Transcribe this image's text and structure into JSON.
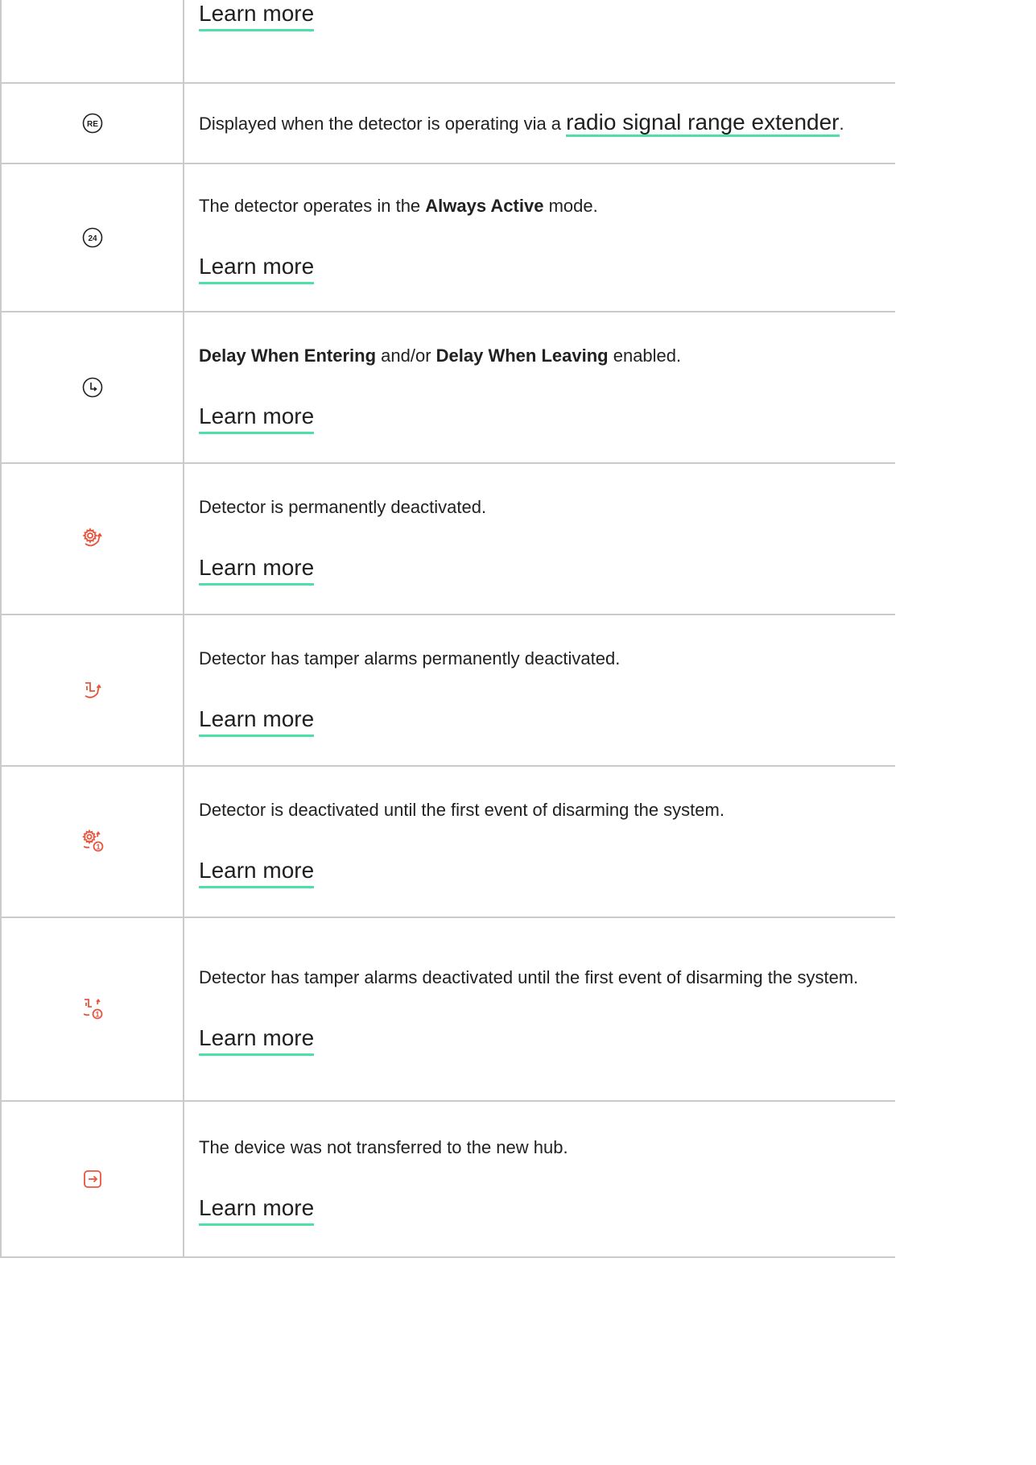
{
  "colors": {
    "accent_underline": "#4fe0a8",
    "icon_red": "#e7553f",
    "icon_dark": "#1f1f1f",
    "border": "#cbcbcb"
  },
  "rows": [
    {
      "icon": "unknown",
      "learn_more": "Learn more"
    },
    {
      "icon": "re-icon",
      "icon_text": "RE",
      "pre": "Displayed when the detector is operating via a ",
      "link": "radio signal range extender",
      "post": "."
    },
    {
      "icon": "24-icon",
      "icon_text": "24",
      "pre": "The detector operates in the ",
      "bold": "Always Active",
      "post": " mode.",
      "learn_more": "Learn more"
    },
    {
      "icon": "clock-arrow-icon",
      "bold1": "Delay When Entering",
      "mid": " and/or ",
      "bold2": "Delay When Leaving",
      "post": " enabled.",
      "learn_more": "Learn more"
    },
    {
      "icon": "gear-deactivated-icon",
      "text": "Detector is permanently deactivated.",
      "learn_more": "Learn more"
    },
    {
      "icon": "tamper-deactivated-icon",
      "text": "Detector has tamper alarms permanently deactivated.",
      "learn_more": "Learn more"
    },
    {
      "icon": "gear-deactivated-once-icon",
      "text": "Detector is deactivated until the first event of disarming the system.",
      "learn_more": "Learn more"
    },
    {
      "icon": "tamper-deactivated-once-icon",
      "text": "Detector has tamper alarms deactivated until the first event of disarming the system.",
      "learn_more": "Learn more"
    },
    {
      "icon": "transfer-icon",
      "text": "The device was not transferred to the new hub.",
      "learn_more": "Learn more"
    }
  ]
}
